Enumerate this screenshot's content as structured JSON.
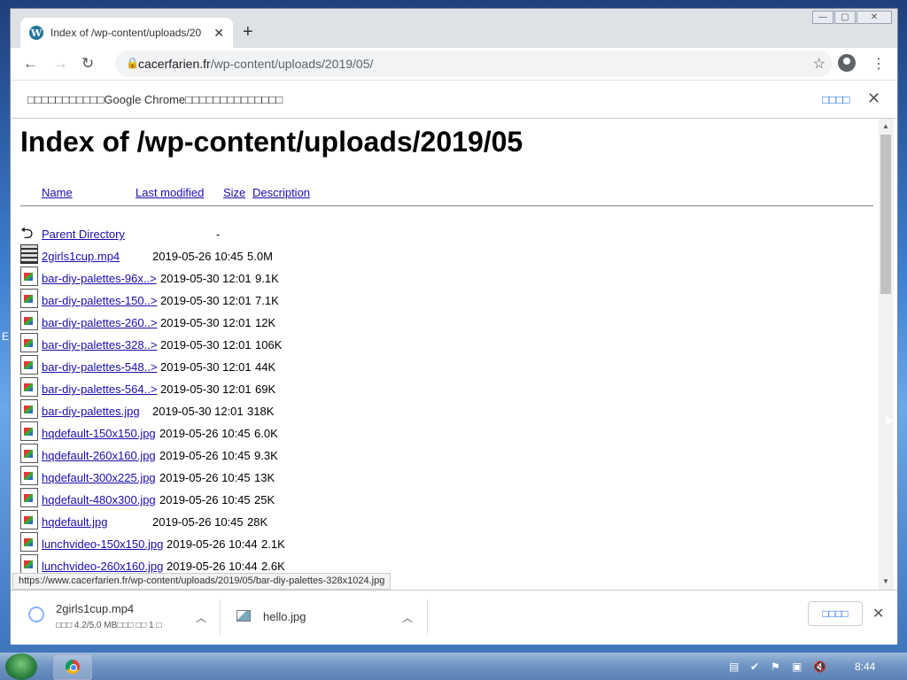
{
  "browser": {
    "tab_title": "Index of /wp-content/uploads/2019/05",
    "tab_favicon": "W",
    "new_tab": "+",
    "url_host": "cacerfarien.fr",
    "url_path": "/wp-content/uploads/2019/05/",
    "win_minimize": "—",
    "win_maximize": "▢",
    "win_close": "✕"
  },
  "infobar": {
    "message": "□□□□□□□□□□□Google Chrome□□□□□□□□□□□□□□",
    "action": "□□□□",
    "close": "✕"
  },
  "page": {
    "heading": "Index of /wp-content/uploads/2019/05",
    "columns": {
      "name": "Name",
      "modified": "Last modified",
      "size": "Size",
      "description": "Description"
    },
    "parent": {
      "name": "Parent Directory",
      "size": "-"
    },
    "rows": [
      {
        "icon": "video-icon",
        "name": "2girls1cup.mp4",
        "modified": "2019-05-26 10:45",
        "size": "5.0M"
      },
      {
        "icon": "image-icon",
        "name": "bar-diy-palettes-96x..>",
        "modified": "2019-05-30 12:01",
        "size": "9.1K"
      },
      {
        "icon": "image-icon",
        "name": "bar-diy-palettes-150..>",
        "modified": "2019-05-30 12:01",
        "size": "7.1K"
      },
      {
        "icon": "image-icon",
        "name": "bar-diy-palettes-260..>",
        "modified": "2019-05-30 12:01",
        "size": "12K"
      },
      {
        "icon": "image-icon",
        "name": "bar-diy-palettes-328..>",
        "modified": "2019-05-30 12:01",
        "size": "106K"
      },
      {
        "icon": "image-icon",
        "name": "bar-diy-palettes-548..>",
        "modified": "2019-05-30 12:01",
        "size": "44K"
      },
      {
        "icon": "image-icon",
        "name": "bar-diy-palettes-564..>",
        "modified": "2019-05-30 12:01",
        "size": "69K"
      },
      {
        "icon": "image-icon",
        "name": "bar-diy-palettes.jpg",
        "modified": "2019-05-30 12:01",
        "size": "318K"
      },
      {
        "icon": "image-icon",
        "name": "hqdefault-150x150.jpg",
        "modified": "2019-05-26 10:45",
        "size": "6.0K"
      },
      {
        "icon": "image-icon",
        "name": "hqdefault-260x160.jpg",
        "modified": "2019-05-26 10:45",
        "size": "9.3K"
      },
      {
        "icon": "image-icon",
        "name": "hqdefault-300x225.jpg",
        "modified": "2019-05-26 10:45",
        "size": "13K"
      },
      {
        "icon": "image-icon",
        "name": "hqdefault-480x300.jpg",
        "modified": "2019-05-26 10:45",
        "size": "25K"
      },
      {
        "icon": "image-icon",
        "name": "hqdefault.jpg",
        "modified": "2019-05-26 10:45",
        "size": "28K"
      },
      {
        "icon": "image-icon",
        "name": "lunchvideo-150x150.jpg",
        "modified": "2019-05-26 10:44",
        "size": "2.1K"
      },
      {
        "icon": "image-icon",
        "name": "lunchvideo-260x160.jpg",
        "modified": "2019-05-26 10:44",
        "size": "2.6K"
      }
    ],
    "status_url": "https://www.cacerfarien.fr/wp-content/uploads/2019/05/bar-diy-palettes-328x1024.jpg"
  },
  "downloads": {
    "items": [
      {
        "name": "2girls1cup.mp4",
        "status": "□□□ 4.2/5.0 MB□□□ □□ 1 □"
      },
      {
        "name": "hello.jpg",
        "status": ""
      }
    ],
    "show_all": "□□□□",
    "close": "✕"
  },
  "taskbar": {
    "clock": "8:44"
  },
  "desktop": {
    "edge_letter": "E"
  }
}
